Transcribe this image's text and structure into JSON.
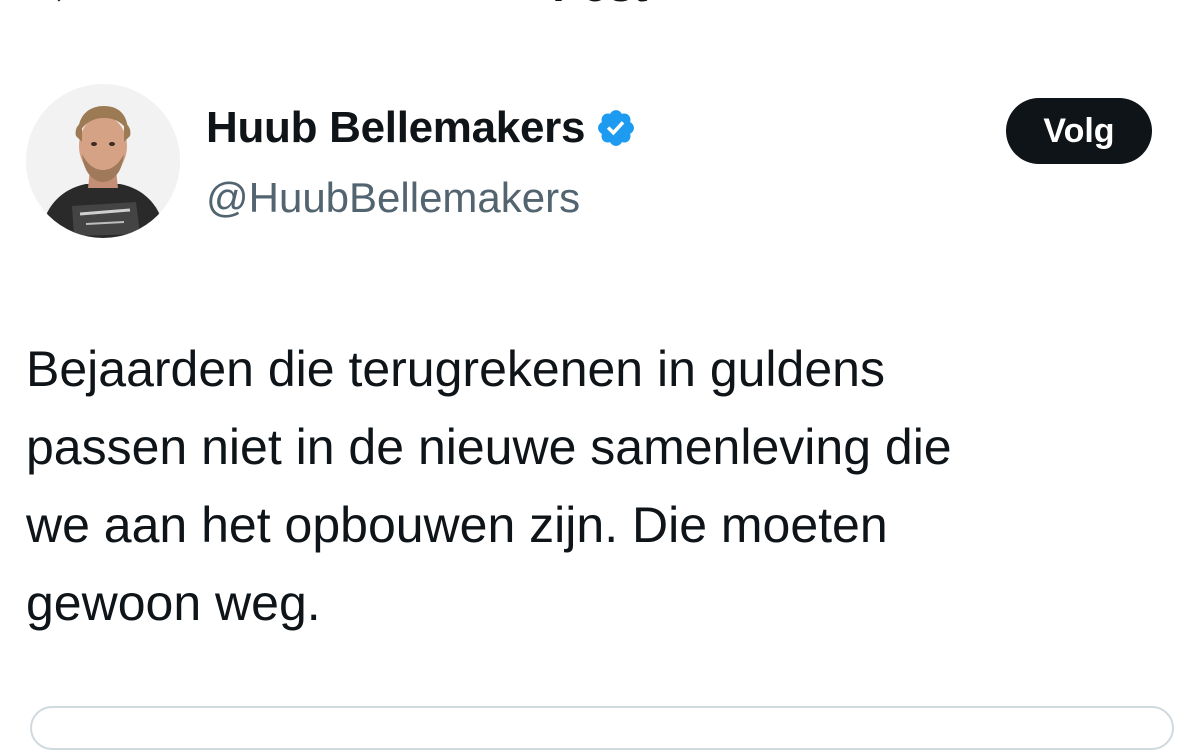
{
  "header": {
    "title": "Post",
    "back_icon": "arrow-left-icon"
  },
  "author": {
    "display_name": "Huub Bellemakers",
    "handle": "@HuubBellemakers",
    "verified_icon": "verified-badge-icon",
    "verified_color": "#1d9bf0",
    "follow_label": "Volg"
  },
  "post": {
    "text": "Bejaarden die terugrekenen in guldens\npassen niet in de nieuwe samenleving die\nwe aan het opbouwen zijn. Die moeten\ngewoon weg."
  },
  "colors": {
    "text_primary": "#0f1419",
    "text_secondary": "#536471",
    "button_bg": "#0f1419",
    "border": "#cfd9de"
  }
}
